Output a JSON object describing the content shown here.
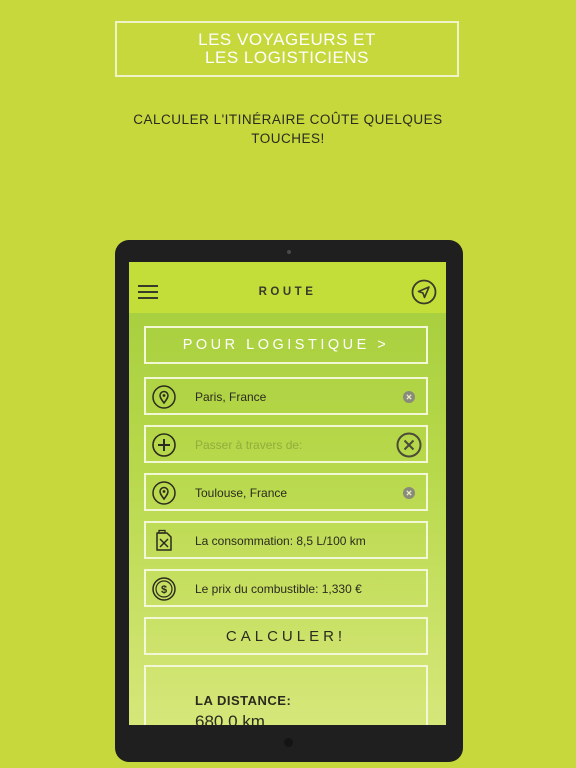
{
  "promo": {
    "title": "LES VOYAGEURS ET\nLES LOGISTICIENS",
    "subtitle": "CALCULER L'ITINÉRAIRE COÛTE QUELQUES TOUCHES!"
  },
  "app": {
    "title": "ROUTE",
    "logistics_button": "POUR LOGISTIQUE >",
    "from": {
      "value": "Paris, France",
      "icon": "location-pin-icon"
    },
    "via": {
      "placeholder": "Passer à travers de:",
      "icon": "plus-circle-icon"
    },
    "to": {
      "value": "Toulouse, France",
      "icon": "location-pin-icon"
    },
    "consumption": {
      "label": "La consommation: 8,5 L/100 km",
      "icon": "fuel-can-icon"
    },
    "fuel_price": {
      "label": "Le prix du combustible: 1,330 €",
      "icon": "coin-dollar-icon"
    },
    "calculate_button": "CALCULER!",
    "result": {
      "label": "LA DISTANCE:",
      "value": "680.0 km"
    }
  },
  "colors": {
    "background": "#c6d83c",
    "topbar": "#c3de39",
    "border": "#f2f7d6",
    "text": "#2b2b1e",
    "device": "#1f1f1f"
  }
}
